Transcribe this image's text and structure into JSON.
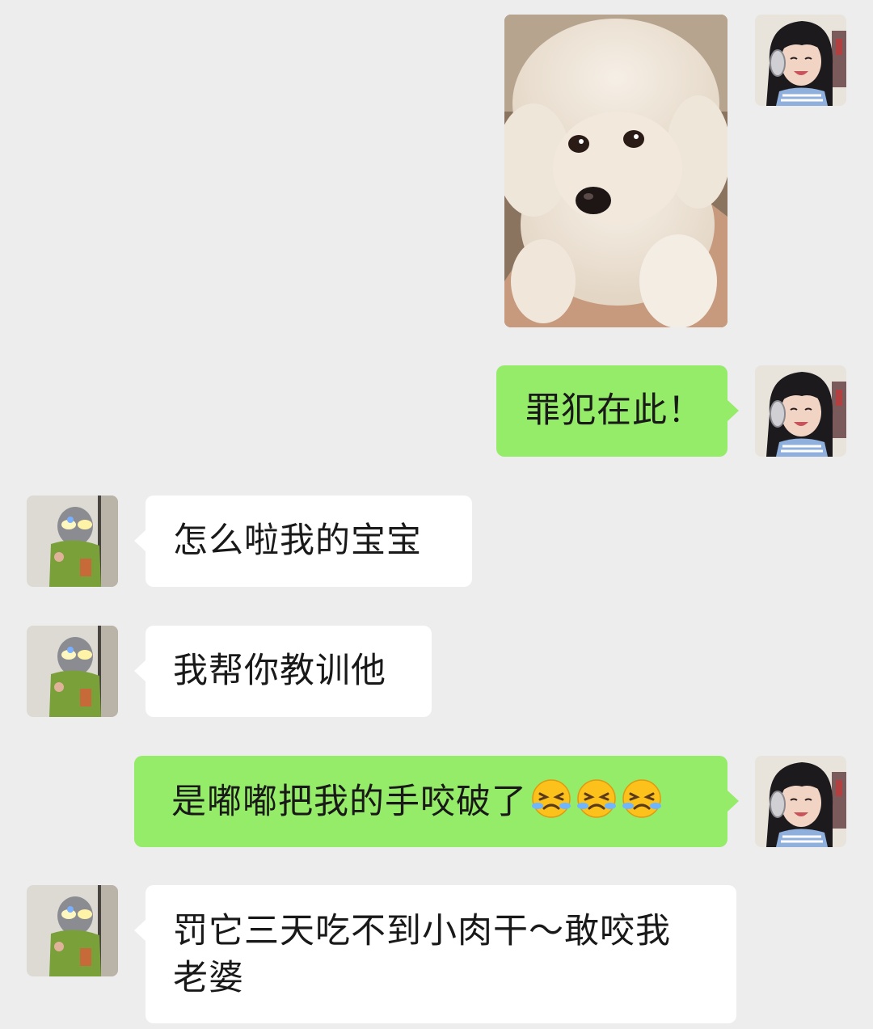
{
  "messages": [
    {
      "from": "me",
      "type": "image",
      "image_subject": "white-poodle-puppy-photo"
    },
    {
      "from": "me",
      "type": "text",
      "text": "罪犯在此！"
    },
    {
      "from": "other",
      "type": "text",
      "text": "怎么啦我的宝宝"
    },
    {
      "from": "other",
      "type": "text",
      "text": "我帮你教训他"
    },
    {
      "from": "me",
      "type": "text",
      "text": "是嘟嘟把我的手咬破了",
      "emojis": [
        "crying-face-emoji",
        "crying-face-emoji",
        "crying-face-emoji"
      ]
    },
    {
      "from": "other",
      "type": "text",
      "text_line1": "罚它三天吃不到小肉干～敢咬我",
      "text_line2": "老婆"
    }
  ],
  "avatars": {
    "me": "girl-with-headphones-avatar",
    "other": "ultraman-figure-avatar"
  },
  "colors": {
    "background": "#ededed",
    "outgoing_bubble": "#95ec69",
    "incoming_bubble": "#ffffff",
    "text": "#191919"
  }
}
